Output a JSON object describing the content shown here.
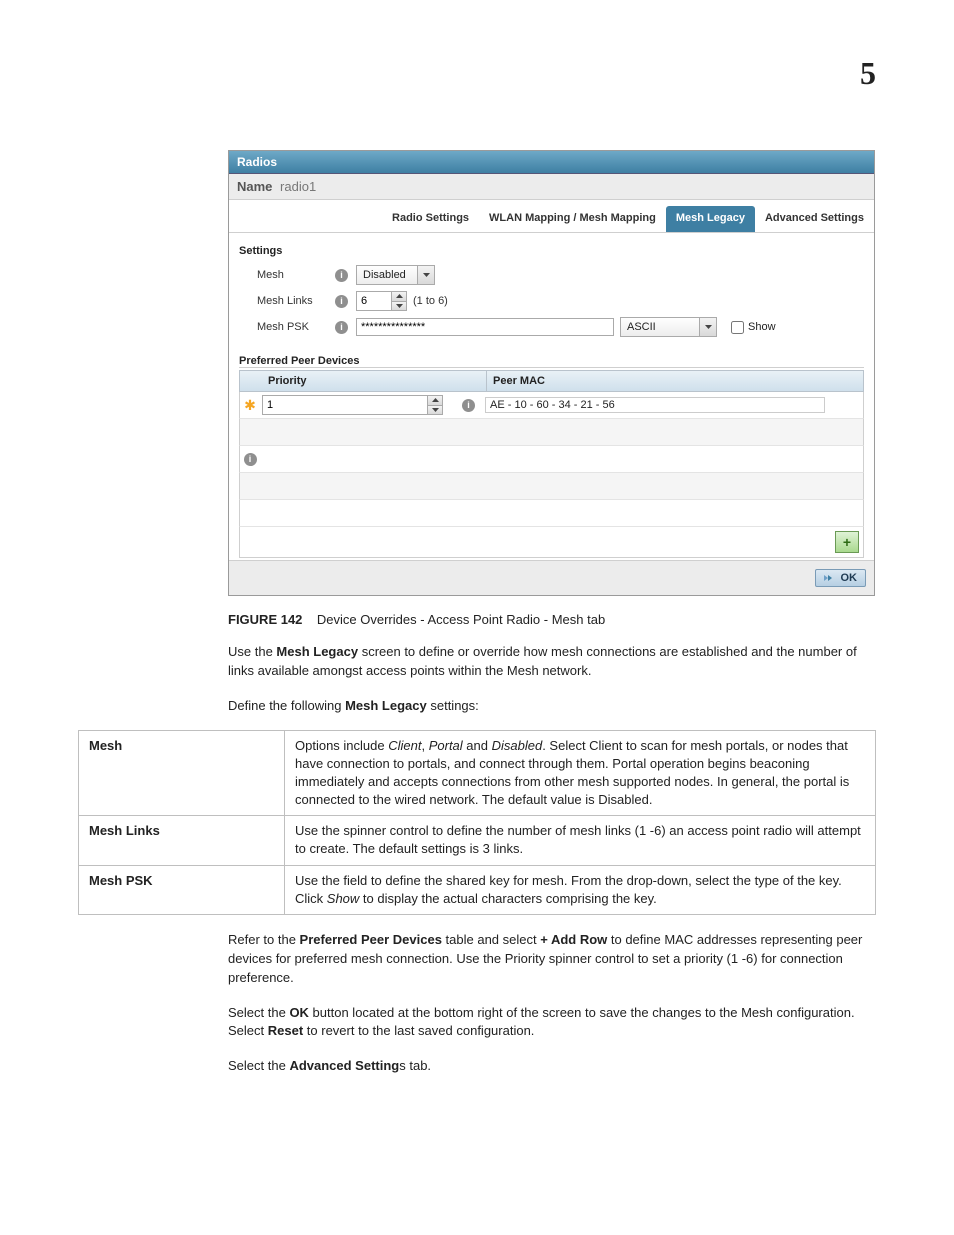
{
  "page_number": "5",
  "shot": {
    "titlebar": "Radios",
    "name_label": "Name",
    "name_value": "radio1",
    "tabs": {
      "radio_settings": "Radio Settings",
      "wlan_mapping": "WLAN Mapping / Mesh Mapping",
      "mesh_legacy": "Mesh Legacy",
      "advanced": "Advanced Settings"
    },
    "settings_header": "Settings",
    "mesh": {
      "label": "Mesh",
      "value": "Disabled"
    },
    "mesh_links": {
      "label": "Mesh Links",
      "value": "6",
      "hint": "(1 to 6)"
    },
    "mesh_psk": {
      "label": "Mesh PSK",
      "value": "***************",
      "encoding": "ASCII",
      "show_label": "Show"
    },
    "preferred_header": "Preferred Peer Devices",
    "peer_cols": {
      "priority": "Priority",
      "mac": "Peer MAC"
    },
    "peer_rows": [
      {
        "priority": "1",
        "mac": "AE - 10 - 60 - 34 - 21 - 56"
      }
    ],
    "ok_label": "OK"
  },
  "caption": {
    "fig": "FIGURE 142",
    "text": "Device Overrides - Access Point Radio - Mesh tab"
  },
  "paras": {
    "p1a": "Use the ",
    "p1b": "Mesh Legacy",
    "p1c": " screen to define or override how mesh connections are established and the number of links available amongst access points within the Mesh network.",
    "p2a": "Define the following ",
    "p2b": "Mesh Legacy",
    "p2c": " settings:",
    "p3a": "Refer to the ",
    "p3b": "Preferred Peer Devices",
    "p3c": " table and select ",
    "p3d": "+ Add Row",
    "p3e": " to define MAC addresses representing peer devices for preferred mesh connection. Use the Priority spinner control to set a priority (1 -6) for connection preference.",
    "p4a": "Select the ",
    "p4b": "OK",
    "p4c": " button located at the bottom right of the screen to save the changes to the Mesh configuration. Select ",
    "p4d": "Reset",
    "p4e": " to revert to the last saved configuration.",
    "p5a": "Select the ",
    "p5b": "Advanced Setting",
    "p5c": "s tab."
  },
  "defs": {
    "r1": {
      "term": "Mesh",
      "t1": "Options include ",
      "i1": "Client",
      "t2": ", ",
      "i2": "Portal",
      "t3": " and ",
      "i3": "Disabled",
      "t4": ". Select Client to scan for mesh portals, or nodes that have connection to portals, and connect through them. Portal operation begins beaconing immediately and accepts connections from other mesh supported nodes. In general, the portal is connected to the wired network. The default value is Disabled."
    },
    "r2": {
      "term": "Mesh Links",
      "text": "Use the spinner control to define the number of mesh links (1 -6) an access point radio will attempt to create. The default settings is 3 links."
    },
    "r3": {
      "term": "Mesh PSK",
      "t1": "Use the field to define the shared key for mesh. From the drop-down, select the type of the key. Click ",
      "i1": "Show",
      "t2": " to display the actual characters comprising the key."
    }
  }
}
